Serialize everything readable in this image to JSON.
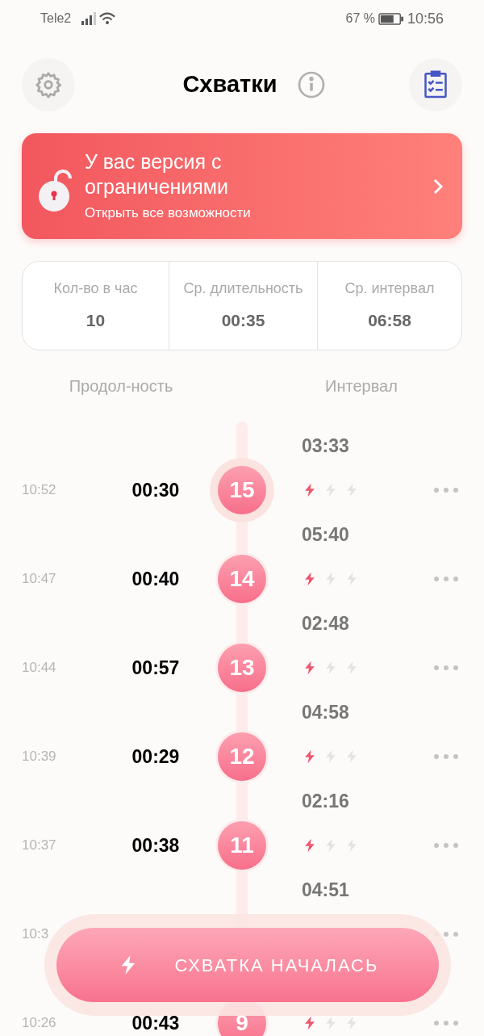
{
  "status_bar": {
    "carrier": "Tele2",
    "battery": "67 %",
    "time": "10:56"
  },
  "header": {
    "title": "Схватки"
  },
  "banner": {
    "title": "У вас версия с ограничениями",
    "subtitle": "Открыть все возможности"
  },
  "stats": [
    {
      "label": "Кол-во в час",
      "value": "10"
    },
    {
      "label": "Ср. длительность",
      "value": "00:35"
    },
    {
      "label": "Ср. интервал",
      "value": "06:58"
    }
  ],
  "columns": {
    "duration": "Продол-ность",
    "interval": "Интервал"
  },
  "contractions": [
    {
      "interval": "03:33",
      "time": "10:52",
      "duration": "00:30",
      "number": "15",
      "stars": 1,
      "highlighted": true
    },
    {
      "interval": "05:40",
      "time": "10:47",
      "duration": "00:40",
      "number": "14",
      "stars": 1,
      "highlighted": false
    },
    {
      "interval": "02:48",
      "time": "10:44",
      "duration": "00:57",
      "number": "13",
      "stars": 1,
      "highlighted": false
    },
    {
      "interval": "04:58",
      "time": "10:39",
      "duration": "00:29",
      "number": "12",
      "stars": 1,
      "highlighted": false
    },
    {
      "interval": "02:16",
      "time": "10:37",
      "duration": "00:38",
      "number": "11",
      "stars": 1,
      "highlighted": false
    },
    {
      "interval": "04:51",
      "time": "10:3"
    },
    {
      "time": "10:26",
      "duration": "00:43",
      "number": "9",
      "stars": 1
    }
  ],
  "start_button": {
    "label": "СХВАТКА НАЧАЛАСЬ"
  }
}
